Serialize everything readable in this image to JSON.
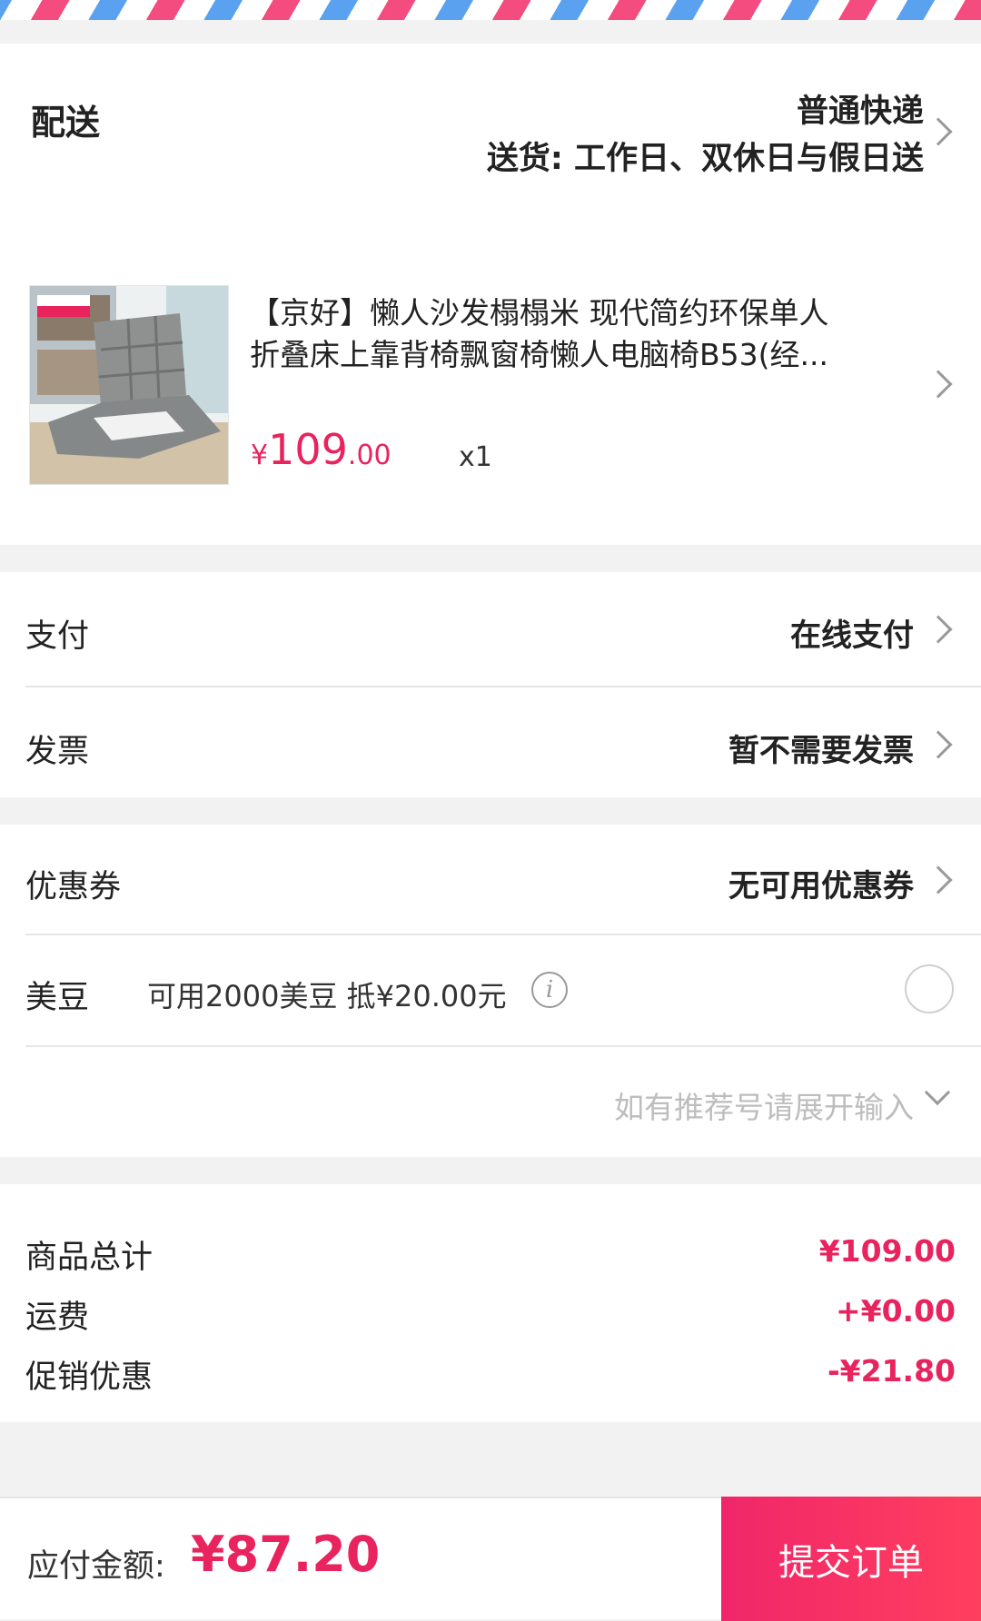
{
  "delivery": {
    "label": "配送",
    "method": "普通快递",
    "schedule": "送货: 工作日、双休日与假日送"
  },
  "product": {
    "title_line1": "【京好】懒人沙发榻榻米 现代简约环保单人",
    "title_line2": "折叠床上靠背椅飘窗椅懒人电脑椅B53(经...",
    "price_symbol": "¥",
    "price_int": "109",
    "price_dec": ".00",
    "quantity": "x1"
  },
  "payment": {
    "label": "支付",
    "value": "在线支付"
  },
  "invoice": {
    "label": "发票",
    "value": "暂不需要发票"
  },
  "coupon": {
    "label": "优惠券",
    "value": "无可用优惠券"
  },
  "beans": {
    "label": "美豆",
    "text": "可用2000美豆 抵¥20.00元"
  },
  "referral": {
    "placeholder": "如有推荐号请展开输入"
  },
  "summary": {
    "items": [
      {
        "label": "商品总计",
        "value": "¥109.00"
      },
      {
        "label": "运费",
        "value": "+¥0.00"
      },
      {
        "label": "促销优惠",
        "value": "-¥21.80"
      }
    ]
  },
  "footer": {
    "total_label": "应付金额:",
    "total_value": "¥87.20",
    "submit_label": "提交订单"
  },
  "colors": {
    "accent": "#e8235e",
    "stripe_pink": "#f44c7f",
    "stripe_blue": "#5aa2f0"
  }
}
